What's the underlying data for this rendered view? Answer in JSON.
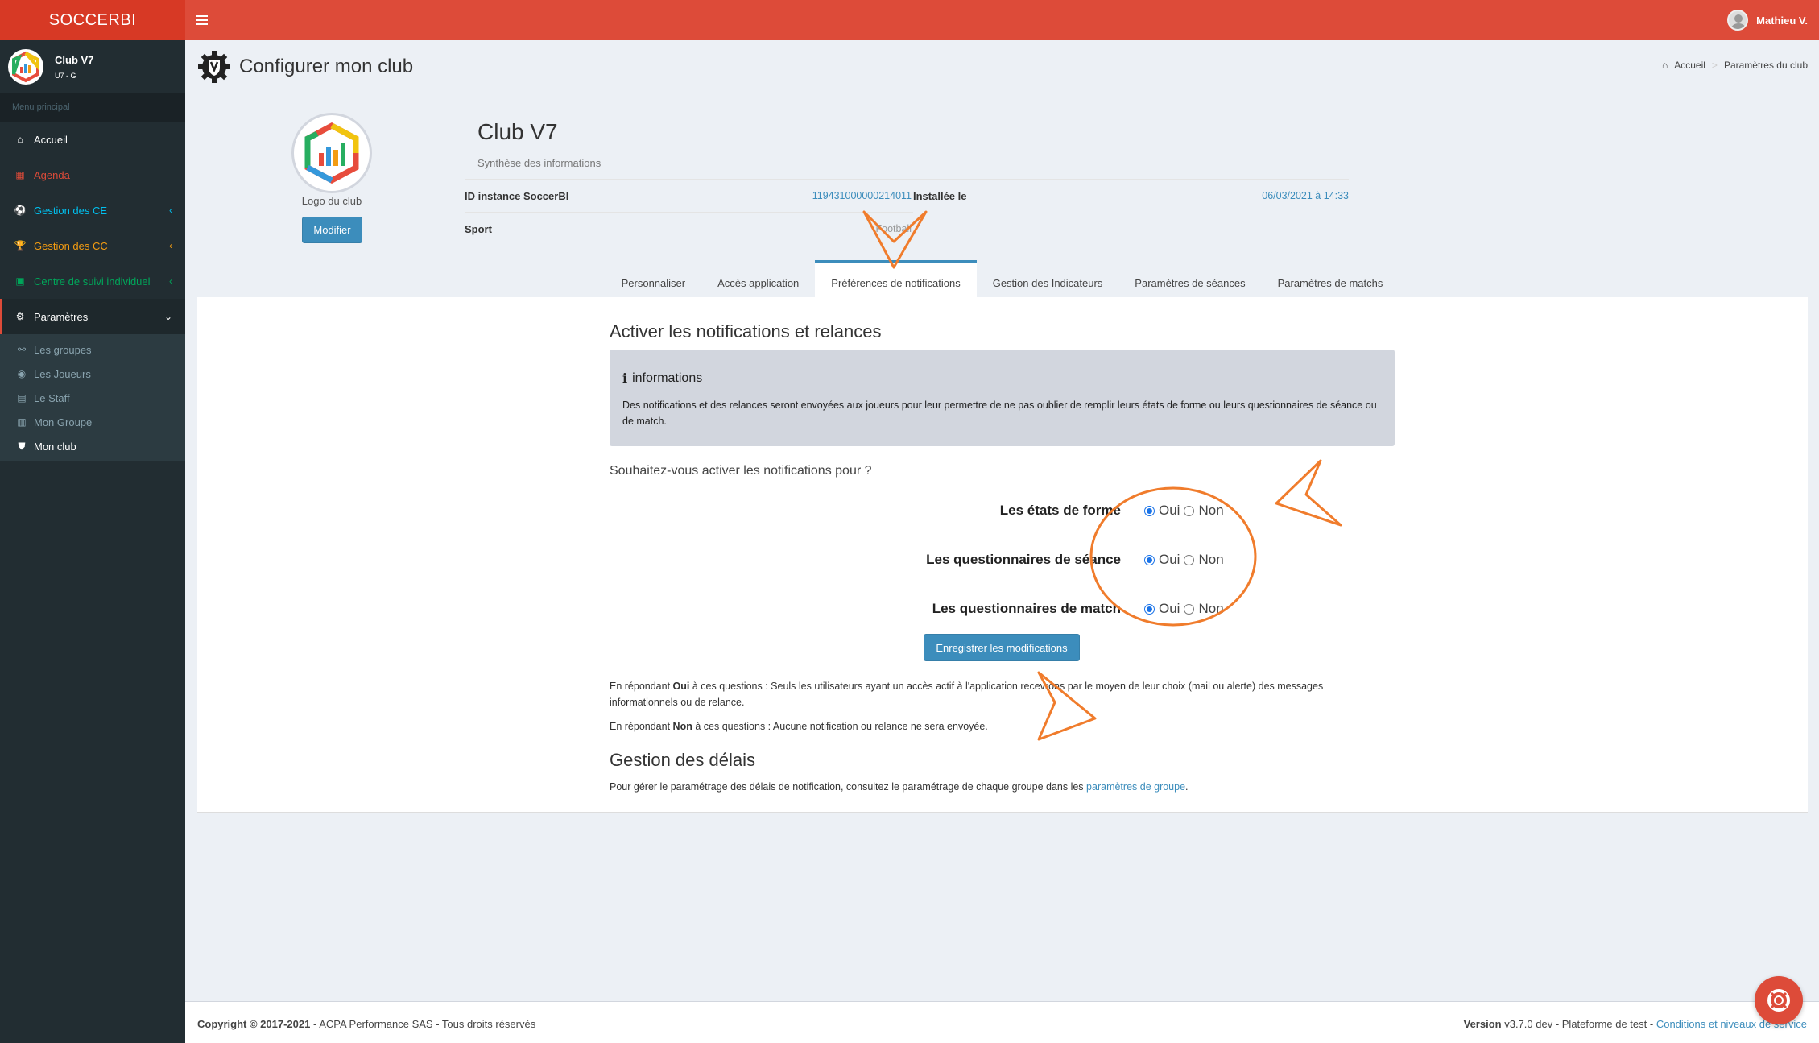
{
  "app": {
    "brand": "SOCCERBI"
  },
  "topbar": {
    "user_name": "Mathieu V."
  },
  "sidebar": {
    "club_name": "Club V7",
    "club_sub": "U7 - G",
    "menu_header": "Menu principal",
    "items": [
      {
        "label": "Accueil",
        "color": "#ffffff"
      },
      {
        "label": "Agenda",
        "color": "#dd4b39"
      },
      {
        "label": "Gestion des CE",
        "color": "#00c0ef"
      },
      {
        "label": "Gestion des CC",
        "color": "#f39c12"
      },
      {
        "label": "Centre de suivi individuel",
        "color": "#00a65a"
      },
      {
        "label": "Paramètres",
        "color": "#ffffff"
      }
    ],
    "sub_items": [
      {
        "label": "Les groupes"
      },
      {
        "label": "Les Joueurs"
      },
      {
        "label": "Le Staff"
      },
      {
        "label": "Mon Groupe"
      },
      {
        "label": "Mon club"
      }
    ]
  },
  "page": {
    "title": "Configurer mon club",
    "breadcrumb": {
      "home": "Accueil",
      "current": "Paramètres du club"
    }
  },
  "profile": {
    "logo_label": "Logo du club",
    "modify_label": "Modifier",
    "club_title": "Club V7",
    "synthesis": "Synthèse des informations",
    "id_label": "ID instance SoccerBI",
    "id_value": "119431000000214011",
    "installed_label": "Installée le",
    "installed_value": "06/03/2021 à 14:33",
    "sport_label": "Sport",
    "sport_value": "Football"
  },
  "tabs": [
    {
      "label": "Personnaliser"
    },
    {
      "label": "Accès application"
    },
    {
      "label": "Préférences de notifications"
    },
    {
      "label": "Gestion des Indicateurs"
    },
    {
      "label": "Paramètres de séances"
    },
    {
      "label": "Paramètres de matchs"
    }
  ],
  "notifications": {
    "title": "Activer les notifications et relances",
    "callout_title": "informations",
    "callout_text": "Des notifications et des relances seront envoyées aux joueurs pour leur permettre de ne pas oublier de remplir leurs états de forme ou leurs questionnaires de séance ou de match.",
    "question": "Souhaitez-vous activer les notifications pour ?",
    "yes_label": "Oui",
    "no_label": "Non",
    "rows": [
      {
        "label": "Les états de forme",
        "selected": "Oui"
      },
      {
        "label": "Les questionnaires de séance",
        "selected": "Oui"
      },
      {
        "label": "Les questionnaires de match",
        "selected": "Oui"
      }
    ],
    "save_label": "Enregistrer les modifications",
    "note_yes_prefix": "En répondant",
    "note_yes_strong": "Oui",
    "note_yes_text": "à ces questions : Seuls les utilisateurs ayant un accès actif à l'application recevrons par le moyen de leur choix (mail ou alerte) des messages informationnels ou de relance.",
    "note_no_prefix": "En répondant",
    "note_no_strong": "Non",
    "note_no_text": "à ces questions : Aucune notification ou relance ne sera envoyée.",
    "delays_title": "Gestion des délais",
    "delays_text": "Pour gérer le paramétrage des délais de notification, consultez le paramétrage de chaque groupe dans les",
    "delays_link": "paramètres de groupe",
    "delays_end": "."
  },
  "footer": {
    "copyright": "Copyright © 2017-2021",
    "company": "- ACPA Performance SAS - Tous droits réservés",
    "version_label": "Version",
    "version_value": "v3.7.0 dev - Plateforme de test -",
    "conditions_link": "Conditions et niveaux de service"
  },
  "colors": {
    "header": "#dd4b39",
    "sidebar": "#222d32",
    "primary": "#3c8dbc",
    "annotation": "#f07c2c"
  }
}
